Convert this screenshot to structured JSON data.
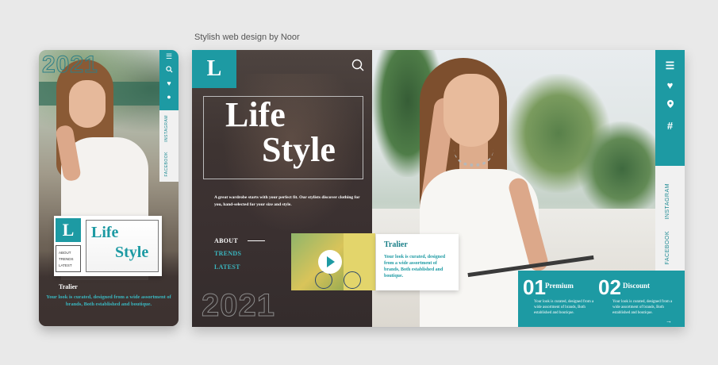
{
  "caption": "Stylish web design by Noor",
  "brand": {
    "logo_letter": "L",
    "year": "2021",
    "title_line1": "Life",
    "title_line2": "Style",
    "accent_color": "#1d9aa3"
  },
  "mobile": {
    "menu_items": [
      "ABOUT",
      "TRENDS",
      "LATEST"
    ],
    "social": [
      "INSTAGRAM",
      "FACEBOOK"
    ],
    "tralier_title": "Tralier",
    "tralier_text": "Your look is curated, designed from a wide assortment of brands, Both established and boutique."
  },
  "desktop": {
    "intro": "A great wardrobe starts with your perfect fit. Our stylists discover clothing for you, hand-selected for your size and style.",
    "nav": [
      {
        "label": "ABOUT",
        "color": "#ffffff"
      },
      {
        "label": "TRENDS",
        "color": "#3ab7c0"
      },
      {
        "label": "LATEST",
        "color": "#3ab7c0"
      }
    ],
    "tralier_title": "Tralier",
    "tralier_text": "Your look is curated, designed from a wide assortment of brands, Both established and boutique.",
    "social": [
      "INSTAGRAM",
      "FACEBOOK"
    ],
    "icons": [
      "menu-icon",
      "heart-icon",
      "location-icon",
      "hashtag-icon"
    ],
    "promos": [
      {
        "num": "01",
        "title": "Premium",
        "text": "Your look is curated, designed from a wide assortment of brands, Both established and boutique."
      },
      {
        "num": "02",
        "title": "Discount",
        "text": "Your look is curated, designed from a wide assortment of brands, Both established and boutique."
      }
    ],
    "arrow": "→"
  }
}
